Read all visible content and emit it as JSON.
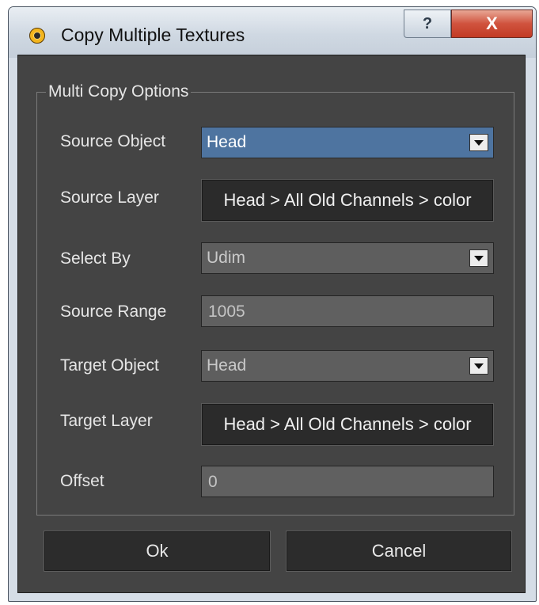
{
  "window": {
    "title": "Copy Multiple Textures",
    "help_label": "?",
    "close_label": "X",
    "app_icon": "app-logo-icon"
  },
  "group": {
    "title": "Multi Copy Options"
  },
  "fields": {
    "source_object": {
      "label": "Source Object",
      "value": "Head"
    },
    "source_layer": {
      "label": "Source Layer",
      "value": "Head > All Old Channels > color"
    },
    "select_by": {
      "label": "Select By",
      "value": "Udim"
    },
    "source_range": {
      "label": "Source Range",
      "value": "1005"
    },
    "target_object": {
      "label": "Target Object",
      "value": "Head"
    },
    "target_layer": {
      "label": "Target Layer",
      "value": "Head > All Old Channels > color"
    },
    "offset": {
      "label": "Offset",
      "value": "0"
    }
  },
  "buttons": {
    "ok": "Ok",
    "cancel": "Cancel"
  },
  "colors": {
    "panel": "#444444",
    "selection": "#4e74a0",
    "close_red": "#c23a24"
  }
}
